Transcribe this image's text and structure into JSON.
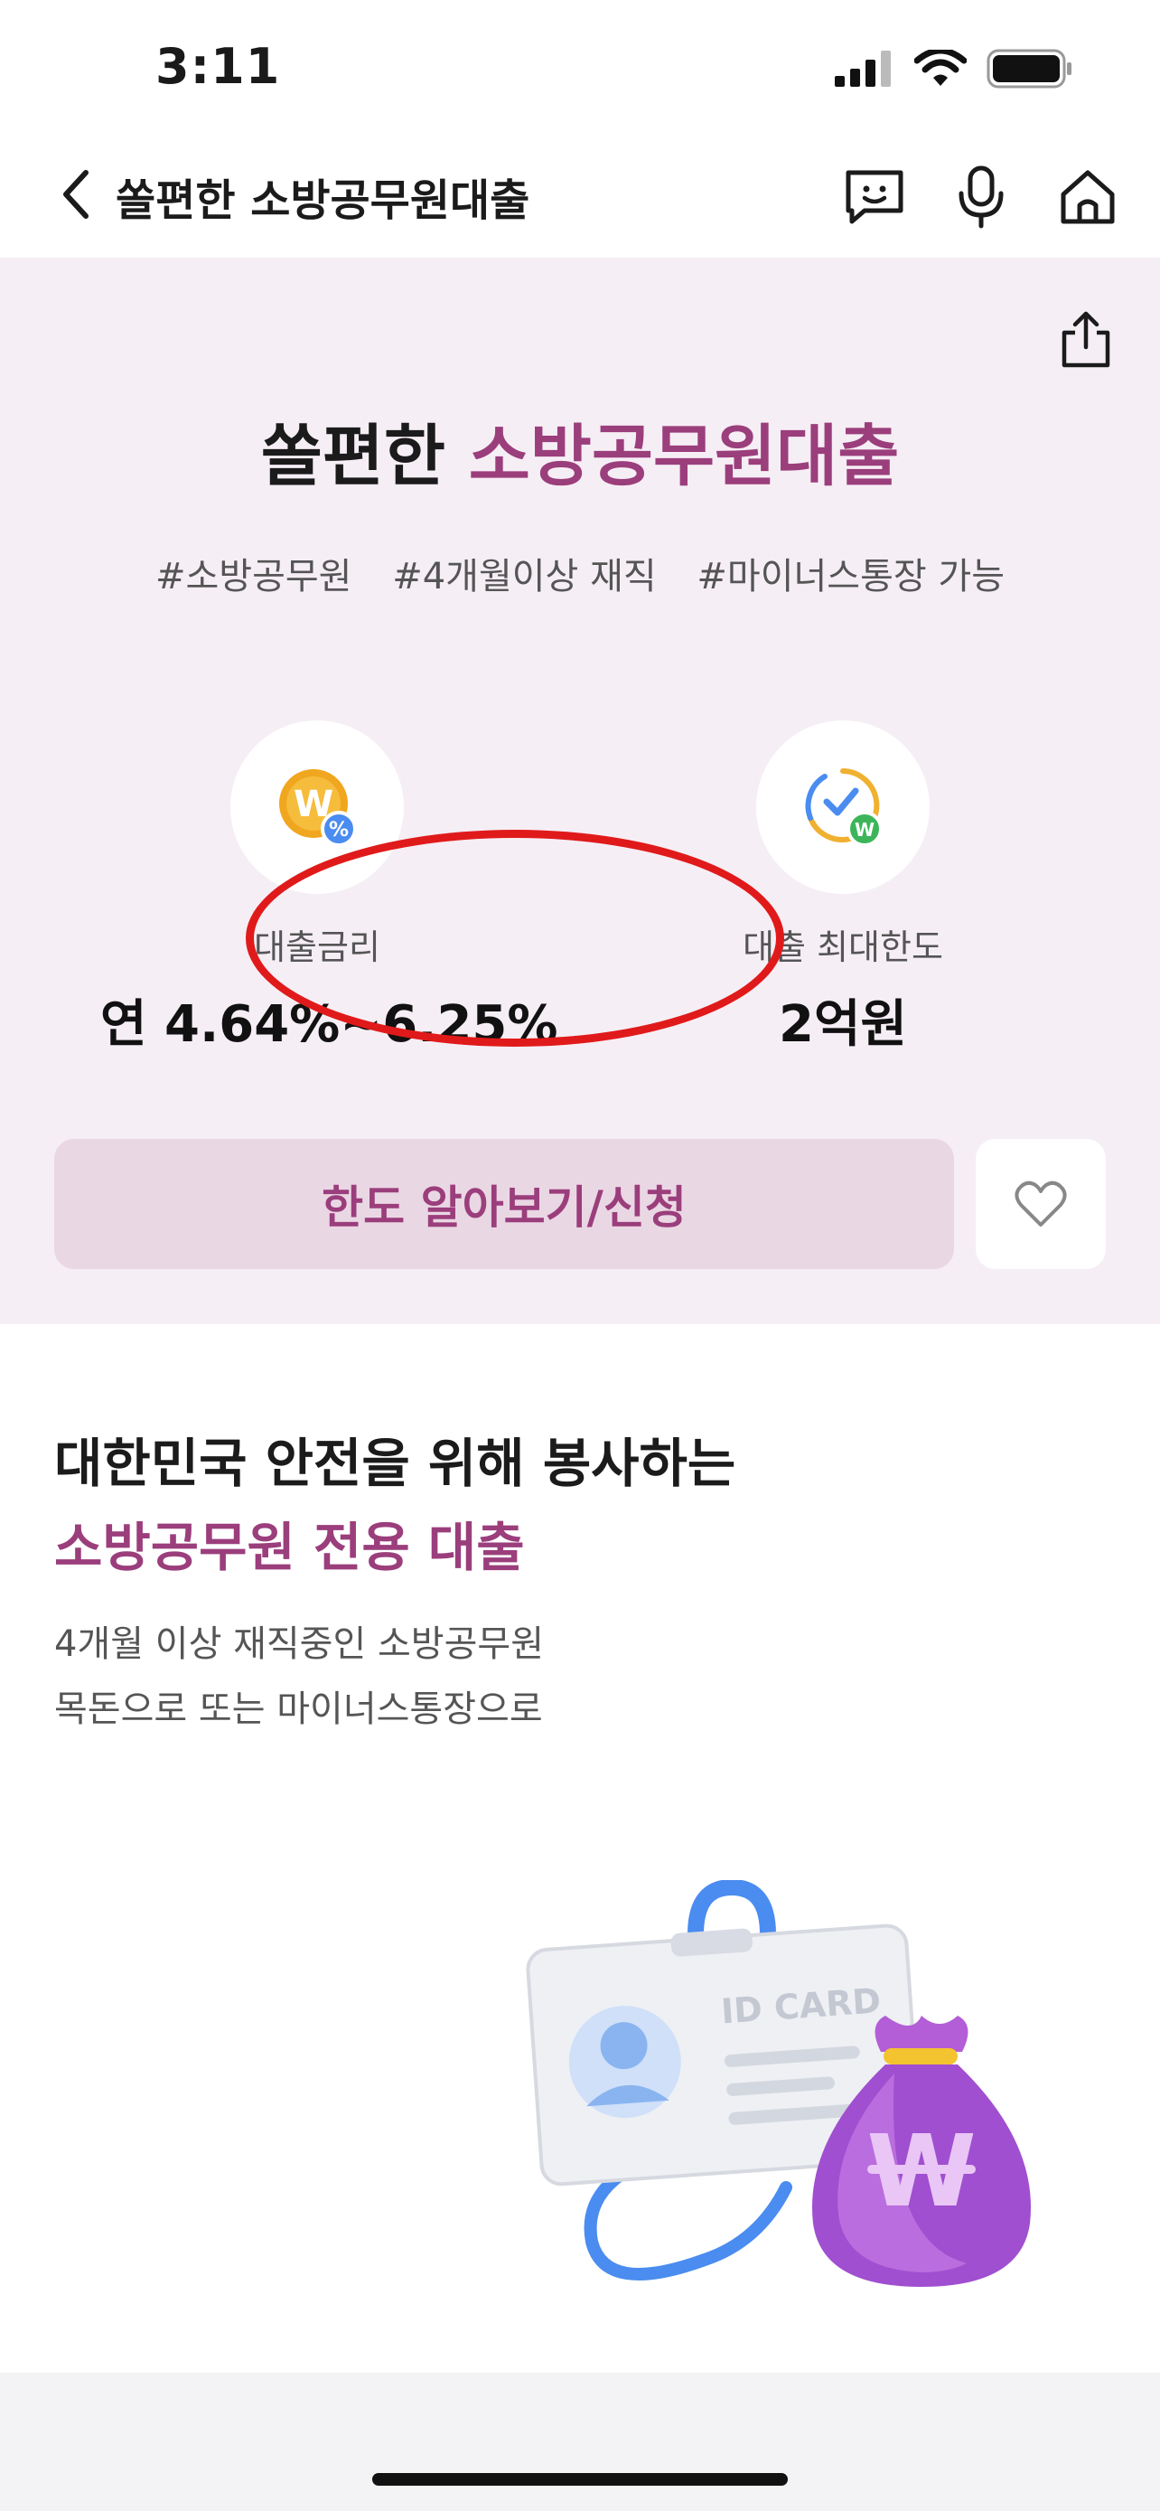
{
  "status_bar": {
    "time": "3:11"
  },
  "nav": {
    "title": "쏠편한 소방공무원대출"
  },
  "hero": {
    "title_prefix": "쏠편한 ",
    "title_accent": "소방공무원대출",
    "tags": [
      "#소방공무원",
      "#4개월이상 재직",
      "#마이너스통장 가능"
    ],
    "rate_label": "대출금리",
    "rate_value": "연 4.64%~6.25%",
    "limit_label": "대출 최대한도",
    "limit_value": "2억원",
    "apply_label": "한도 알아보기/신청"
  },
  "content": {
    "headline_1": "대한민국 안전을 위해 봉사하는",
    "headline_2": "소방공무원 전용 대출",
    "desc_1": "4개월 이상 재직중인 소방공무원",
    "desc_2": "목돈으로 또는 마이너스통장으로",
    "illustration_text": "ID CARD"
  },
  "colors": {
    "accent": "#9b3e7c",
    "hero_bg": "#f6eef5",
    "button_bg": "#ead7e4",
    "annotation_red": "#e01a1a"
  },
  "icons": [
    "back-icon",
    "chatbot-icon",
    "microphone-icon",
    "home-icon",
    "share-icon",
    "coin-percent-icon",
    "limit-check-icon",
    "heart-icon",
    "id-card-icon",
    "money-bag-icon"
  ]
}
